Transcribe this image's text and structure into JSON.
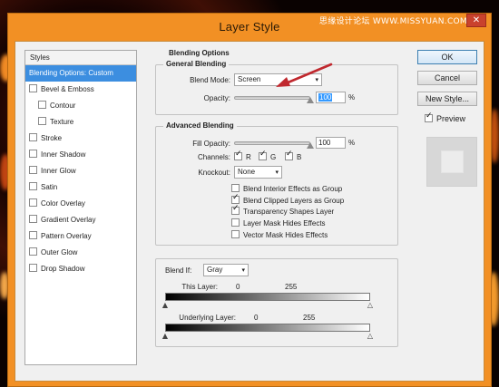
{
  "window": {
    "title": "Layer Style",
    "watermark": "思缘设计论坛 WWW.MISSYUAN.COM",
    "close_icon": "close-icon"
  },
  "styles_panel": {
    "header": "Styles",
    "items": [
      {
        "label": "Blending Options: Custom",
        "selected": true,
        "checkbox": false,
        "indent": false
      },
      {
        "label": "Bevel & Emboss",
        "selected": false,
        "checkbox": true,
        "checked": false,
        "indent": false
      },
      {
        "label": "Contour",
        "selected": false,
        "checkbox": true,
        "checked": false,
        "indent": true
      },
      {
        "label": "Texture",
        "selected": false,
        "checkbox": true,
        "checked": false,
        "indent": true
      },
      {
        "label": "Stroke",
        "selected": false,
        "checkbox": true,
        "checked": false,
        "indent": false
      },
      {
        "label": "Inner Shadow",
        "selected": false,
        "checkbox": true,
        "checked": false,
        "indent": false
      },
      {
        "label": "Inner Glow",
        "selected": false,
        "checkbox": true,
        "checked": false,
        "indent": false
      },
      {
        "label": "Satin",
        "selected": false,
        "checkbox": true,
        "checked": false,
        "indent": false
      },
      {
        "label": "Color Overlay",
        "selected": false,
        "checkbox": true,
        "checked": false,
        "indent": false
      },
      {
        "label": "Gradient Overlay",
        "selected": false,
        "checkbox": true,
        "checked": false,
        "indent": false
      },
      {
        "label": "Pattern Overlay",
        "selected": false,
        "checkbox": true,
        "checked": false,
        "indent": false
      },
      {
        "label": "Outer Glow",
        "selected": false,
        "checkbox": true,
        "checked": false,
        "indent": false
      },
      {
        "label": "Drop Shadow",
        "selected": false,
        "checkbox": true,
        "checked": false,
        "indent": false
      }
    ]
  },
  "blending_options": {
    "title": "Blending Options",
    "general": {
      "title": "General Blending",
      "blend_mode_label": "Blend Mode:",
      "blend_mode_value": "Screen",
      "opacity_label": "Opacity:",
      "opacity_value": "100",
      "opacity_unit": "%"
    },
    "advanced": {
      "title": "Advanced Blending",
      "fill_opacity_label": "Fill Opacity:",
      "fill_opacity_value": "100",
      "fill_opacity_unit": "%",
      "channels_label": "Channels:",
      "channels": [
        {
          "label": "R",
          "checked": true
        },
        {
          "label": "G",
          "checked": true
        },
        {
          "label": "B",
          "checked": true
        }
      ],
      "knockout_label": "Knockout:",
      "knockout_value": "None",
      "options": [
        {
          "label": "Blend Interior Effects as Group",
          "checked": false
        },
        {
          "label": "Blend Clipped Layers as Group",
          "checked": true
        },
        {
          "label": "Transparency Shapes Layer",
          "checked": true
        },
        {
          "label": "Layer Mask Hides Effects",
          "checked": false
        },
        {
          "label": "Vector Mask Hides Effects",
          "checked": false
        }
      ]
    },
    "blend_if": {
      "label": "Blend If:",
      "value": "Gray",
      "this_layer_label": "This Layer:",
      "this_layer_min": "0",
      "this_layer_max": "255",
      "underlying_label": "Underlying Layer:",
      "underlying_min": "0",
      "underlying_max": "255"
    }
  },
  "buttons": {
    "ok": "OK",
    "cancel": "Cancel",
    "new_style": "New Style...",
    "preview_label": "Preview",
    "preview_checked": true
  },
  "colors": {
    "title_bar": "#f29024",
    "selection": "#3c8ee0",
    "annotation_arrow": "#c0282e"
  }
}
